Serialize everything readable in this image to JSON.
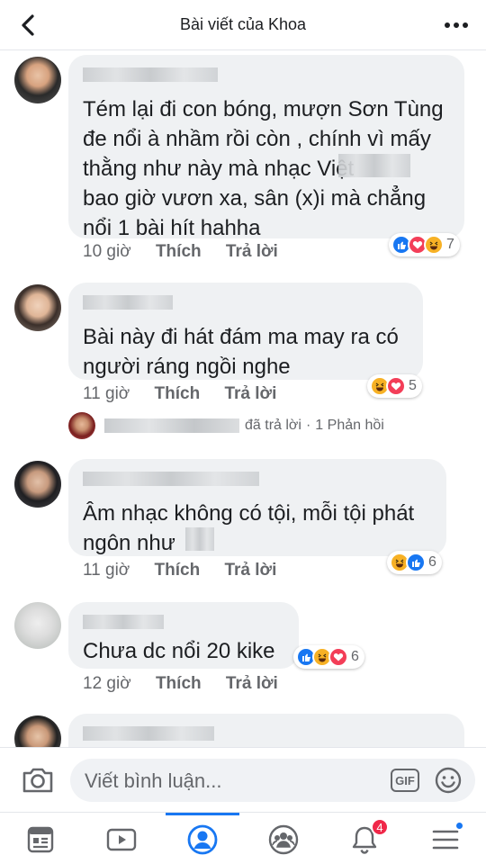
{
  "header": {
    "title": "Bài viết của Khoa"
  },
  "comments": [
    {
      "text": "Tém lại đi con bóng, mượn Sơn Tùng\nđe nổi à nhầm rồi còn , chính vì mấy\nthằng như này mà nhạc Việt\nbao giờ vươn xa, sân (x)i mà chẳng\nnổi 1 bài hít hahha",
      "time": "10 giờ",
      "like": "Thích",
      "reply": "Trả lời",
      "reactions": [
        "like",
        "love",
        "haha"
      ],
      "count": "7"
    },
    {
      "text": "Bài này đi hát đám ma may ra có\nngười ráng ngồi nghe",
      "time": "11 giờ",
      "like": "Thích",
      "reply": "Trả lời",
      "reactions": [
        "haha",
        "love"
      ],
      "count": "5"
    },
    {
      "text": "Âm nhạc không có tội, mỗi tội phát\nngôn như",
      "time": "11 giờ",
      "like": "Thích",
      "reply": "Trả lời",
      "reactions": [
        "haha",
        "like"
      ],
      "count": "6"
    },
    {
      "text": "Chưa dc nổi 20 kike",
      "time": "12 giờ",
      "like": "Thích",
      "reply": "Trả lời",
      "reactions": [
        "like",
        "haha",
        "love"
      ],
      "count": "6"
    }
  ],
  "reply_summary": {
    "replied": "đã trả lời",
    "separator": "·",
    "count": "1 Phản hồi"
  },
  "composer": {
    "placeholder": "Viết bình luận...",
    "gif": "GIF"
  },
  "nav": {
    "notifications_badge": "4"
  },
  "colors": {
    "accent": "#1877f2",
    "bubble": "#eff1f3",
    "badge": "#f02849"
  }
}
